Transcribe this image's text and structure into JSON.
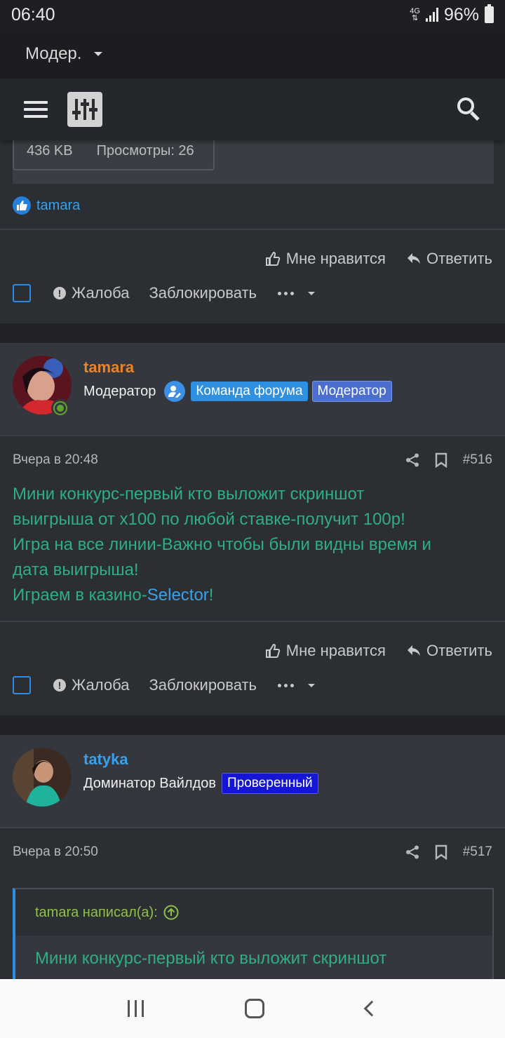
{
  "status": {
    "time": "06:40",
    "network": "4G",
    "battery": "96%"
  },
  "top_dropdown": {
    "label": "Модер."
  },
  "attachment": {
    "size": "436 KB",
    "views": "Просмотры: 26"
  },
  "reaction": {
    "user": "tamara"
  },
  "actions": {
    "like": "Мне нравится",
    "reply": "Ответить",
    "report": "Жалоба",
    "block": "Заблокировать"
  },
  "posts": [
    {
      "username": "tamara",
      "username_color": "#e8842a",
      "user_title": "Модератор",
      "badges": [
        {
          "label": "Команда форума",
          "color": "#2f8fe0"
        },
        {
          "label": "Модератор",
          "color": "#4a6fd1"
        }
      ],
      "date": "Вчера в 20:48",
      "number": "#516",
      "lines": [
        "Мини конкурс-первый кто выложит скриншот",
        "выигрыша от х100 по любой ставке-получит 100р!",
        "Игра на все линии-Важно чтобы были видны время и",
        "дата выигрыша!"
      ],
      "last_line_prefix": "Играем в казино-",
      "last_line_link": "Selector",
      "last_line_suffix": "!"
    },
    {
      "username": "tatyka",
      "username_color": "#3aa0ea",
      "user_title": "Доминатор Вайлдов",
      "badges": [
        {
          "label": "Проверенный",
          "color": "#1515d6"
        }
      ],
      "date": "Вчера в 20:50",
      "number": "#517",
      "quote_author": "tamara написал(а):",
      "quote_text": "Мини конкурс-первый кто выложит скриншот"
    }
  ],
  "colors": {
    "accent": "#2d8ce6",
    "post_text": "#2fae86",
    "quote_author": "#8fc04a"
  }
}
